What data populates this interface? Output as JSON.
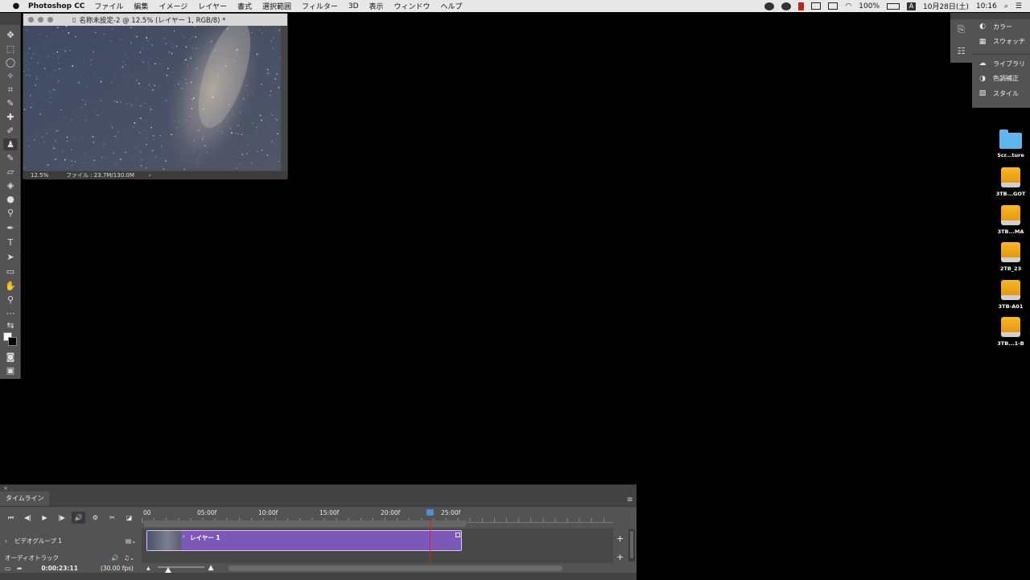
{
  "menubar": {
    "app_name": "Photoshop CC",
    "items": [
      "ファイル",
      "編集",
      "イメージ",
      "レイヤー",
      "書式",
      "選択範囲",
      "フィルター",
      "3D",
      "表示",
      "ウィンドウ",
      "ヘルプ"
    ],
    "battery": "100%",
    "input_source": "A",
    "datetime": "10月28日(土)",
    "time": "10:16"
  },
  "document": {
    "title": "名称未設定-2 @ 12.5% (レイヤー 1, RGB/8) *",
    "zoom": "12.5%",
    "file_info": "ファイル : 23.7M/130.0M"
  },
  "panels": {
    "items": [
      {
        "label": "カラー",
        "icon": "color-icon"
      },
      {
        "label": "スウォッチ",
        "icon": "swatches-icon"
      },
      {
        "label": "ライブラリ",
        "icon": "libraries-icon"
      },
      {
        "label": "色調補正",
        "icon": "adjustments-icon"
      },
      {
        "label": "スタイル",
        "icon": "styles-icon"
      }
    ]
  },
  "desktop": {
    "icons": [
      {
        "label": "Scr...ture",
        "kind": "folder"
      },
      {
        "label": "3TB...GOT",
        "kind": "drive"
      },
      {
        "label": "3TB...MA",
        "kind": "drive"
      },
      {
        "label": "2TB_23",
        "kind": "drive"
      },
      {
        "label": "3TB-A01",
        "kind": "drive"
      },
      {
        "label": "3TB...1-B",
        "kind": "drive"
      }
    ]
  },
  "timeline": {
    "tab_label": "タイムライン",
    "ruler_ticks": [
      "00",
      "05:00f",
      "10:00f",
      "15:00f",
      "20:00f",
      "25:00f"
    ],
    "video_group": "ビデオグループ 1",
    "clip_label": "レイヤー 1",
    "audio_track": "オーディオトラック",
    "current_time": "0:00:23:11",
    "fps": "(30.00 fps)",
    "colors": {
      "clip": "#7c58b8",
      "playhead": "#d0281f"
    }
  }
}
